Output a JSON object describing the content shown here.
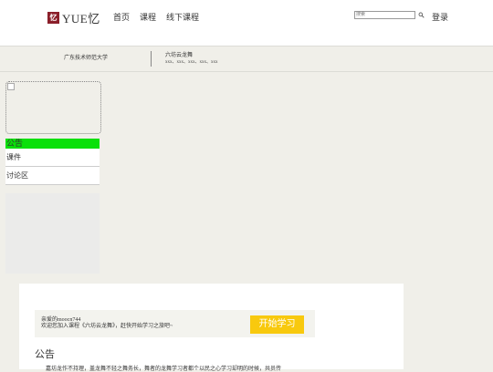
{
  "header": {
    "logo_mark": "忆",
    "logo_text": "YUE忆",
    "nav": [
      "首页",
      "课程",
      "线下课程"
    ],
    "search_placeholder": "搜索",
    "login": "登录"
  },
  "course": {
    "school": "广东技术师范大学",
    "name": "六坊云龙舞",
    "teachers": "xxx、xxx、xxx、xxx、xxx"
  },
  "sidebar": {
    "items": [
      "公告",
      "课件",
      "讨论区"
    ]
  },
  "welcome": {
    "line1": "亲爱的moocn744",
    "line2": "欢迎您加入课程《六坊云龙舞》，赶快开始学习之旅吧~",
    "button": "开始学习"
  },
  "notice": {
    "title": "公告",
    "text": "嘉坊龙作不持理，盖龙舞不轻之舞务长，舞者的龙舞学习者都个以民之心学习却明的时候，共员传"
  },
  "colors": {
    "logo_red": "#8b1f2a",
    "active_green": "#0ae00a",
    "button_yellow": "#f8c90e",
    "page_bg": "#f0efe9"
  }
}
